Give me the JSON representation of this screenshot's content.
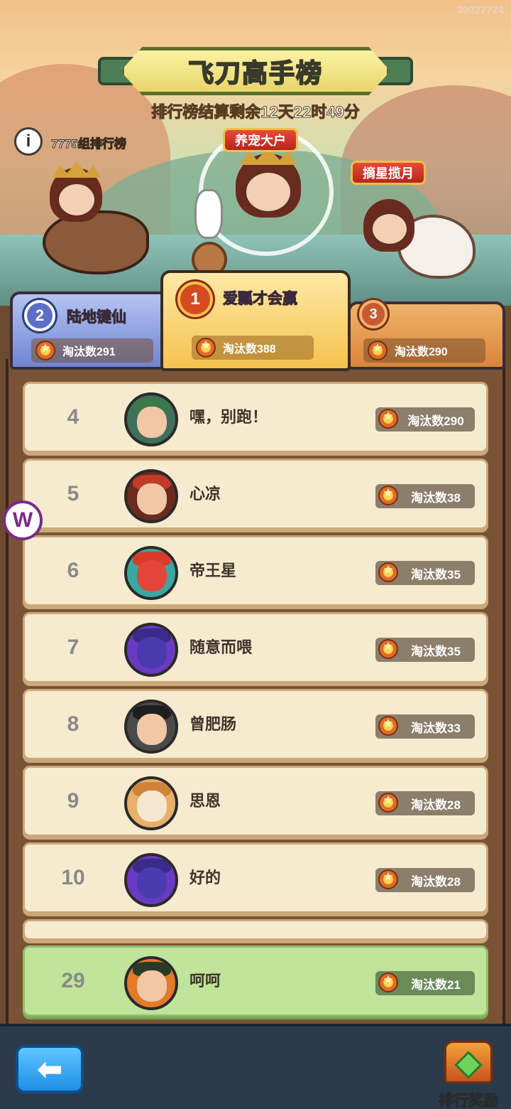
{
  "watermark": "39027724",
  "header": {
    "title": "飞刀高手榜",
    "countdown": "排行榜结算剩余12天22时49分",
    "group_label": "7775组排行榜",
    "info_icon": "i"
  },
  "top3": [
    {
      "rank": "2",
      "name": "陆地键仙",
      "score": "淘汰数291",
      "title_tag": ""
    },
    {
      "rank": "1",
      "name": "爱瓢才会赢",
      "score": "淘汰数388",
      "title_tag": "养宠大户"
    },
    {
      "rank": "3",
      "name": "",
      "score": "淘汰数290",
      "title_tag": "摘星揽月"
    }
  ],
  "rows": [
    {
      "rank": "4",
      "name": "嘿，别跑！",
      "score": "淘汰数290"
    },
    {
      "rank": "5",
      "name": "心凉",
      "score": "淘汰数38"
    },
    {
      "rank": "6",
      "name": "帝王星",
      "score": "淘汰数35"
    },
    {
      "rank": "7",
      "name": "随意而喂",
      "score": "淘汰数35"
    },
    {
      "rank": "8",
      "name": "曾肥肠",
      "score": "淘汰数33"
    },
    {
      "rank": "9",
      "name": "思恩",
      "score": "淘汰数28"
    },
    {
      "rank": "10",
      "name": "好的",
      "score": "淘汰数28"
    }
  ],
  "self": {
    "rank": "29",
    "name": "呵呵",
    "score": "淘汰数21"
  },
  "bottom": {
    "back_icon": "⬅",
    "reward_label": "排行奖励"
  },
  "side_logo": "W"
}
